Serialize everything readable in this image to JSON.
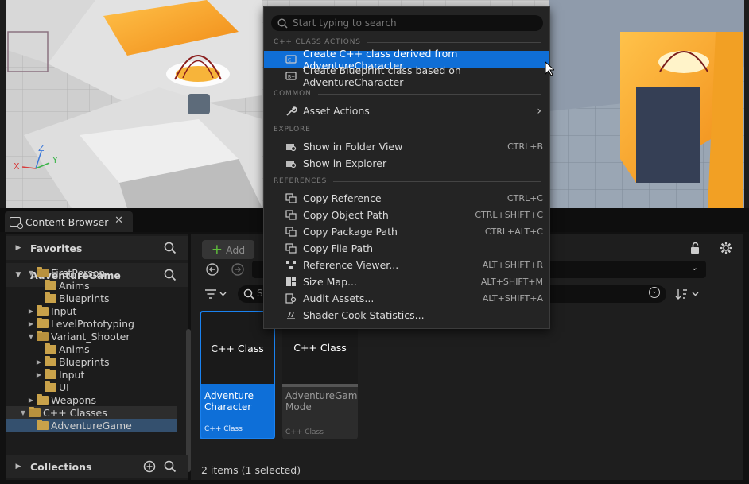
{
  "viewport": {
    "axes": {
      "x": "X",
      "y": "Y",
      "z": "Z"
    }
  },
  "content_browser": {
    "tab_title": "Content Browser",
    "tab_close": "✕",
    "favorites_label": "Favorites",
    "project_label": "AdventureGame",
    "collections_label": "Collections",
    "tree": [
      {
        "label": "FirstPerson",
        "depth": 1,
        "state": "open"
      },
      {
        "label": "Anims",
        "depth": 2,
        "state": "leaf"
      },
      {
        "label": "Blueprints",
        "depth": 2,
        "state": "leaf"
      },
      {
        "label": "Input",
        "depth": 1,
        "state": "closed"
      },
      {
        "label": "LevelPrototyping",
        "depth": 1,
        "state": "closed"
      },
      {
        "label": "Variant_Shooter",
        "depth": 1,
        "state": "open"
      },
      {
        "label": "Anims",
        "depth": 2,
        "state": "leaf"
      },
      {
        "label": "Blueprints",
        "depth": 2,
        "state": "closed"
      },
      {
        "label": "Input",
        "depth": 2,
        "state": "closed"
      },
      {
        "label": "UI",
        "depth": 2,
        "state": "leaf"
      },
      {
        "label": "Weapons",
        "depth": 1,
        "state": "closed"
      },
      {
        "label": "C++ Classes",
        "depth": 0,
        "state": "open"
      },
      {
        "label": "AdventureGame",
        "depth": 1,
        "state": "leaf"
      }
    ],
    "add_button": "Add",
    "search_placeholder": "S",
    "assets": [
      {
        "thumb": "C++ Class",
        "name": "Adventure Character",
        "kind": "C++ Class",
        "selected": true
      },
      {
        "thumb": "C++ Class",
        "name": "AdventureGame Mode",
        "kind": "C++ Class",
        "selected": false
      }
    ],
    "status": "2 items (1 selected)"
  },
  "context_menu": {
    "search_placeholder": "Start typing to search",
    "sections": [
      {
        "title": "C++ CLASS ACTIONS",
        "items": [
          {
            "label": "Create C++ class derived from AdventureCharacter",
            "shortcut": "",
            "icon": "cpp-class-icon",
            "highlighted": true
          },
          {
            "label": "Create Blueprint class based on AdventureCharacter",
            "shortcut": "",
            "icon": "blueprint-class-icon"
          }
        ]
      },
      {
        "title": "COMMON",
        "items": [
          {
            "label": "Asset Actions",
            "shortcut": "",
            "icon": "wrench-icon",
            "submenu": true
          }
        ]
      },
      {
        "title": "EXPLORE",
        "items": [
          {
            "label": "Show in Folder View",
            "shortcut": "CTRL+B",
            "icon": "folder-search-icon"
          },
          {
            "label": "Show in Explorer",
            "shortcut": "",
            "icon": "folder-search-icon"
          }
        ]
      },
      {
        "title": "REFERENCES",
        "items": [
          {
            "label": "Copy Reference",
            "shortcut": "CTRL+C",
            "icon": "copy-icon"
          },
          {
            "label": "Copy Object Path",
            "shortcut": "CTRL+SHIFT+C",
            "icon": "copy-icon"
          },
          {
            "label": "Copy Package Path",
            "shortcut": "CTRL+ALT+C",
            "icon": "copy-icon"
          },
          {
            "label": "Copy File Path",
            "shortcut": "",
            "icon": "copy-icon"
          },
          {
            "label": "Reference Viewer...",
            "shortcut": "ALT+SHIFT+R",
            "icon": "reference-viewer-icon"
          },
          {
            "label": "Size Map...",
            "shortcut": "ALT+SHIFT+M",
            "icon": "size-map-icon"
          },
          {
            "label": "Audit Assets...",
            "shortcut": "ALT+SHIFT+A",
            "icon": "audit-icon"
          },
          {
            "label": "Shader Cook Statistics...",
            "shortcut": "",
            "icon": "shader-icon"
          }
        ]
      }
    ]
  },
  "colors": {
    "accent": "#0f6ed6",
    "folder": "#c9a24a",
    "add_plus": "#5fbf3c"
  }
}
